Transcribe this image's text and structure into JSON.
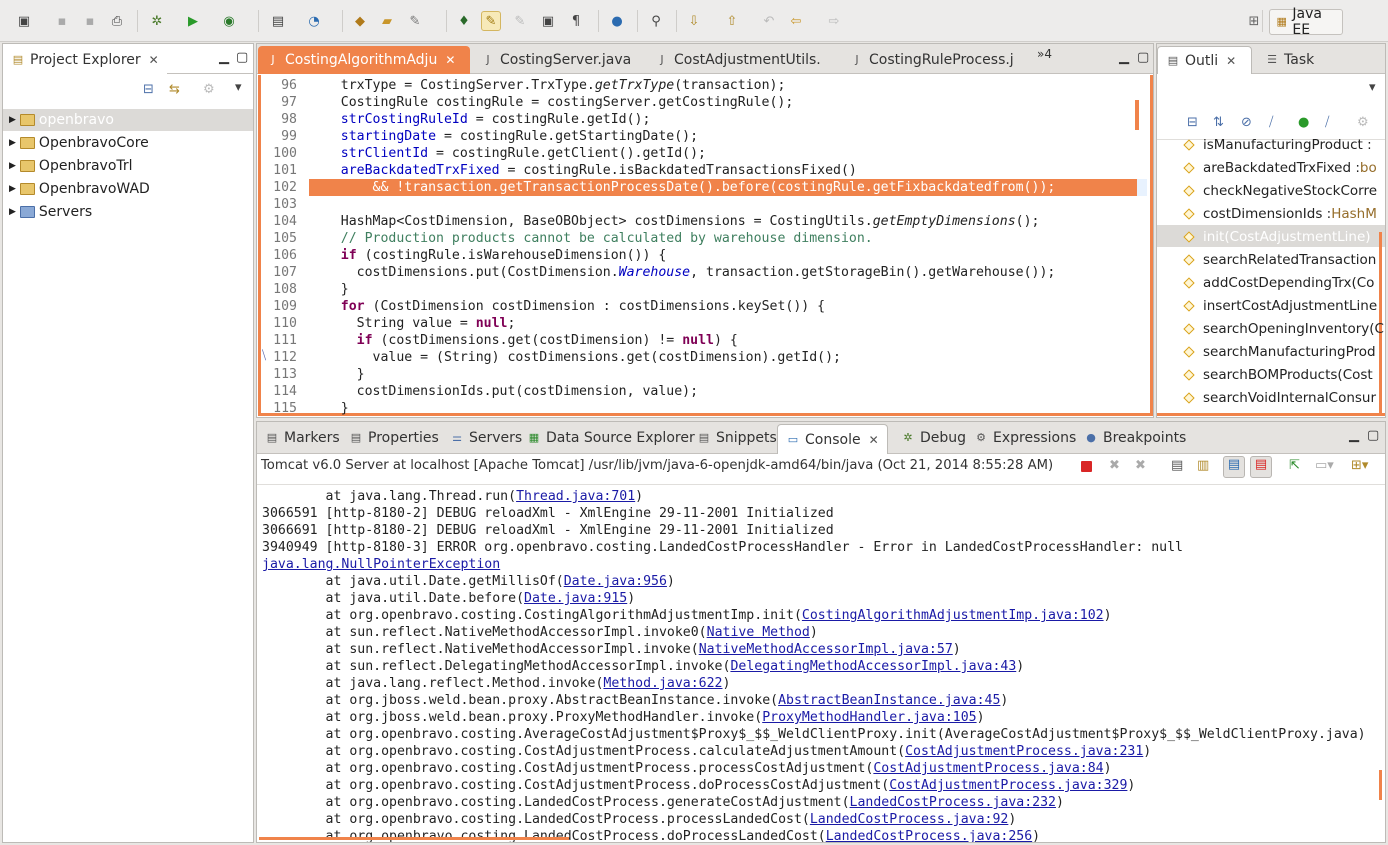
{
  "perspective": "Java EE",
  "explorer": {
    "title": "Project Explorer",
    "items": [
      "openbravo",
      "OpenbravoCore",
      "OpenbravoTrl",
      "OpenbravoWAD",
      "Servers"
    ]
  },
  "editor": {
    "tabs": [
      "CostingAlgorithmAdju",
      "CostingServer.java",
      "CostAdjustmentUtils.",
      "CostingRuleProcess.j"
    ],
    "overflow": "»4",
    "lines": [
      {
        "n": "96",
        "html": "    trxType = CostingServer.TrxType.<i>getTrxType</i>(transaction);"
      },
      {
        "n": "97",
        "html": "    CostingRule costingRule = costingServer.getCostingRule();"
      },
      {
        "n": "98",
        "html": "    <span class='fld'>strCostingRuleId</span> = costingRule.getId();"
      },
      {
        "n": "99",
        "html": "    <span class='fld'>startingDate</span> = costingRule.getStartingDate();"
      },
      {
        "n": "100",
        "html": "    <span class='fld'>strClientId</span> = costingRule.getClient().getId();"
      },
      {
        "n": "101",
        "html": "    <span class='fld'>areBackdatedTrxFixed</span> = costingRule.isBackdatedTransactionsFixed()"
      },
      {
        "n": "102",
        "html": "        &amp;&amp; !transaction.getTransactionProcessDate().before(costingRule.getFixbackdatedfrom());"
      },
      {
        "n": "103",
        "html": ""
      },
      {
        "n": "104",
        "html": "    HashMap&lt;CostDimension, BaseOBObject&gt; costDimensions = CostingUtils.<i>getEmptyDimensions</i>();"
      },
      {
        "n": "105",
        "html": "    <span class='cm'>// Production products cannot be calculated by warehouse dimension.</span>"
      },
      {
        "n": "106",
        "html": "    <span class='kw'>if</span> (costingRule.isWarehouseDimension()) {"
      },
      {
        "n": "107",
        "html": "      costDimensions.put(CostDimension.<i class='fld'>Warehouse</i>, transaction.getStorageBin().getWarehouse());"
      },
      {
        "n": "108",
        "html": "    }"
      },
      {
        "n": "109",
        "html": "    <span class='kw'>for</span> (CostDimension costDimension : costDimensions.keySet()) {"
      },
      {
        "n": "110",
        "html": "      String value = <span class='kw'>null</span>;"
      },
      {
        "n": "111",
        "html": "      <span class='kw'>if</span> (costDimensions.get(costDimension) != <span class='kw'>null</span>) {"
      },
      {
        "n": "112",
        "html": "        value = (String) costDimensions.get(costDimension).getId();"
      },
      {
        "n": "113",
        "html": "      }"
      },
      {
        "n": "114",
        "html": "      costDimensionIds.put(costDimension, value);"
      },
      {
        "n": "115",
        "html": "    }"
      }
    ]
  },
  "outline": {
    "tabs": [
      "Outli",
      "Task"
    ],
    "items": [
      {
        "name": "isManufacturingProduct :",
        "type": ""
      },
      {
        "name": "areBackdatedTrxFixed :",
        "type": " bo"
      },
      {
        "name": "checkNegativeStockCorre",
        "type": ""
      },
      {
        "name": "costDimensionIds :",
        "type": " HashM"
      },
      {
        "name": "init(CostAdjustmentLine)",
        "type": ""
      },
      {
        "name": "searchRelatedTransaction",
        "type": ""
      },
      {
        "name": "addCostDependingTrx(Co",
        "type": ""
      },
      {
        "name": "insertCostAdjustmentLine",
        "type": ""
      },
      {
        "name": "searchOpeningInventory(C",
        "type": ""
      },
      {
        "name": "searchManufacturingProd",
        "type": ""
      },
      {
        "name": "searchBOMProducts(Cost",
        "type": ""
      },
      {
        "name": "searchVoidInternalConsur",
        "type": ""
      }
    ]
  },
  "bottom": {
    "tabs": [
      "Markers",
      "Properties",
      "Servers",
      "Data Source Explorer",
      "Snippets",
      "Console",
      "Debug",
      "Expressions",
      "Breakpoints"
    ],
    "console_title": "Tomcat v6.0 Server at localhost [Apache Tomcat] /usr/lib/jvm/java-6-openjdk-amd64/bin/java (Oct 21, 2014 8:55:28 AM)",
    "lines": [
      {
        "pre": "        at java.lang.Thread.run(",
        "link": "Thread.java:701",
        "post": ")"
      },
      {
        "pre": "3066591 [http-8180-2] DEBUG reloadXml - XmlEngine 29-11-2001 Initialized",
        "link": "",
        "post": ""
      },
      {
        "pre": "3066691 [http-8180-2] DEBUG reloadXml - XmlEngine 29-11-2001 Initialized",
        "link": "",
        "post": ""
      },
      {
        "pre": "3940949 [http-8180-3] ERROR org.openbravo.costing.LandedCostProcessHandler - Error in LandedCostProcessHandler: null",
        "link": "",
        "post": ""
      },
      {
        "pre": "",
        "link": "java.lang.NullPointerException",
        "post": ""
      },
      {
        "pre": "        at java.util.Date.getMillisOf(",
        "link": "Date.java:956",
        "post": ")"
      },
      {
        "pre": "        at java.util.Date.before(",
        "link": "Date.java:915",
        "post": ")"
      },
      {
        "pre": "        at org.openbravo.costing.CostingAlgorithmAdjustmentImp.init(",
        "link": "CostingAlgorithmAdjustmentImp.java:102",
        "post": ")"
      },
      {
        "pre": "        at sun.reflect.NativeMethodAccessorImpl.invoke0(",
        "link": "Native Method",
        "post": ")"
      },
      {
        "pre": "        at sun.reflect.NativeMethodAccessorImpl.invoke(",
        "link": "NativeMethodAccessorImpl.java:57",
        "post": ")"
      },
      {
        "pre": "        at sun.reflect.DelegatingMethodAccessorImpl.invoke(",
        "link": "DelegatingMethodAccessorImpl.java:43",
        "post": ")"
      },
      {
        "pre": "        at java.lang.reflect.Method.invoke(",
        "link": "Method.java:622",
        "post": ")"
      },
      {
        "pre": "        at org.jboss.weld.bean.proxy.AbstractBeanInstance.invoke(",
        "link": "AbstractBeanInstance.java:45",
        "post": ")"
      },
      {
        "pre": "        at org.jboss.weld.bean.proxy.ProxyMethodHandler.invoke(",
        "link": "ProxyMethodHandler.java:105",
        "post": ")"
      },
      {
        "pre": "        at org.openbravo.costing.AverageCostAdjustment$Proxy$_$$_WeldClientProxy.init(AverageCostAdjustment$Proxy$_$$_WeldClientProxy.java)",
        "link": "",
        "post": ""
      },
      {
        "pre": "        at org.openbravo.costing.CostAdjustmentProcess.calculateAdjustmentAmount(",
        "link": "CostAdjustmentProcess.java:231",
        "post": ")"
      },
      {
        "pre": "        at org.openbravo.costing.CostAdjustmentProcess.processCostAdjustment(",
        "link": "CostAdjustmentProcess.java:84",
        "post": ")"
      },
      {
        "pre": "        at org.openbravo.costing.CostAdjustmentProcess.doProcessCostAdjustment(",
        "link": "CostAdjustmentProcess.java:329",
        "post": ")"
      },
      {
        "pre": "        at org.openbravo.costing.LandedCostProcess.generateCostAdjustment(",
        "link": "LandedCostProcess.java:232",
        "post": ")"
      },
      {
        "pre": "        at org.openbravo.costing.LandedCostProcess.processLandedCost(",
        "link": "LandedCostProcess.java:92",
        "post": ")"
      },
      {
        "pre": "        at org.openbravo.costing.LandedCostProcess.doProcessLandedCost(",
        "link": "LandedCostProcess.java:256",
        "post": ")"
      }
    ]
  }
}
